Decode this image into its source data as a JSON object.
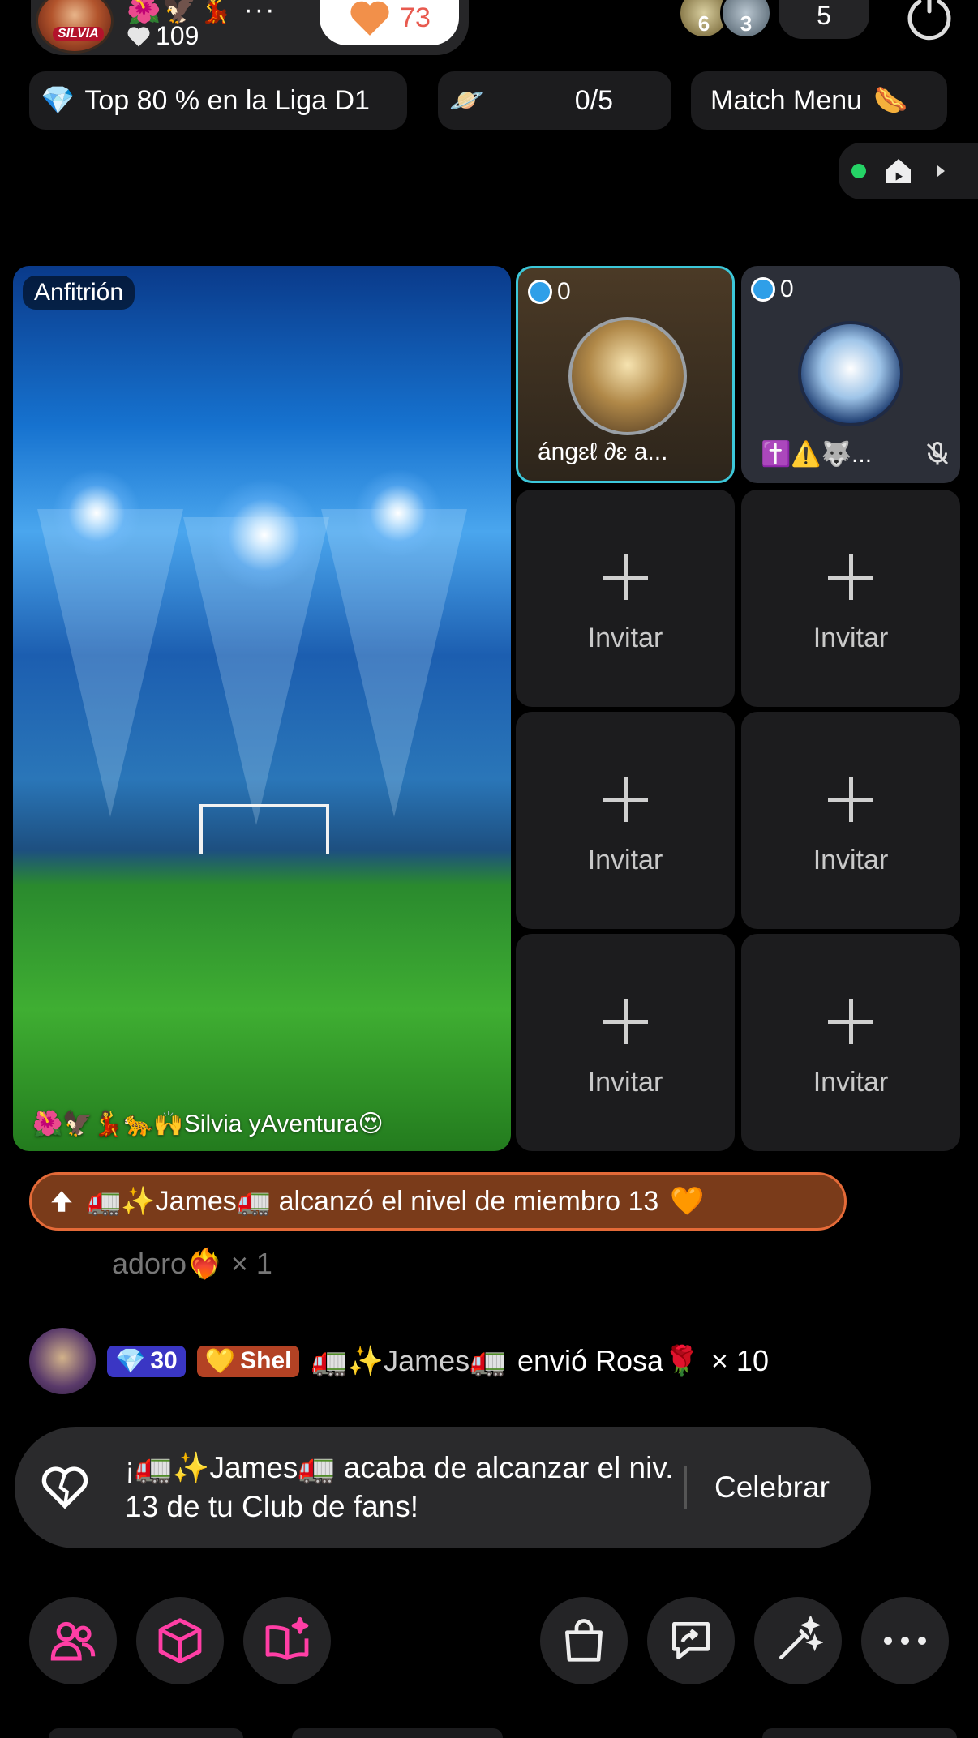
{
  "header": {
    "host_badge": "SILVIA",
    "host_emojis": "🌺🦅💃 ···",
    "likes": "109",
    "like_chip_value": "73",
    "viewer_avatars": [
      {
        "label": "6"
      },
      {
        "label": "3"
      }
    ],
    "viewer_count": "5"
  },
  "status_row": {
    "league_text": "Top 80 % en la Liga D1",
    "tasks_value": "0/5",
    "match_menu_label": "Match Menu",
    "match_menu_emoji": "🌭",
    "league_emoji": "💎",
    "tasks_emoji": "🪐"
  },
  "host_seat": {
    "tag": "Anfitrión",
    "name": "🌺🦅💃🐆🙌Silvia yAventura😍"
  },
  "guest_seats": [
    {
      "score": "0",
      "name": "ángɛℓ ∂ɛ a..."
    },
    {
      "score": "0",
      "name": "✝️⚠️🐺..."
    }
  ],
  "invite_label": "Invitar",
  "notifications": {
    "level_up": "🚛✨James🚛 alcanzó el nivel de miembro 13",
    "level_up_emoji": "🧡",
    "faded_gift": "adoro❤️‍🔥 × 1",
    "gift": {
      "level": "30",
      "fan_badge": "Shel",
      "sender": "🚛✨James🚛",
      "message": "envió Rosa🌹",
      "count": "× 10"
    },
    "fanclub": {
      "text": "¡🚛✨James🚛 acaba de alcanzar el niv. 13 de tu Club de fans!",
      "action": "Celebrar"
    }
  },
  "toolbar": {
    "items": [
      "people-icon",
      "cube-icon",
      "book-sparkle-icon",
      "shopping-bag-icon",
      "share-message-icon",
      "magic-wand-icon",
      "more-icon"
    ]
  },
  "colors": {
    "accent_pink": "#ff3ea5",
    "level_banner_bg": "#7a3b1a",
    "level_banner_border": "#e46a38",
    "seat_highlight": "#3cc7d9",
    "like_red": "#e85a4f"
  }
}
